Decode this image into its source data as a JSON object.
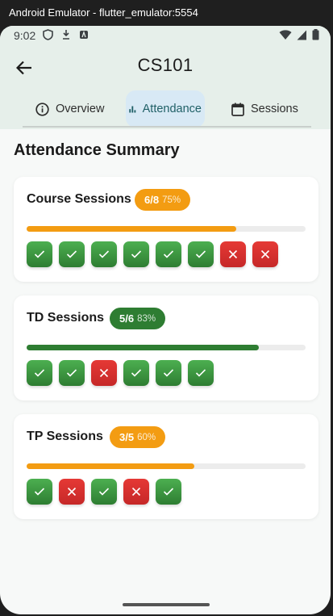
{
  "window": {
    "title": "Android Emulator - flutter_emulator:5554"
  },
  "status_bar": {
    "time": "9:02"
  },
  "app_bar": {
    "title": "CS101"
  },
  "tabs": [
    {
      "label": "Overview",
      "icon": "info-icon",
      "active": false
    },
    {
      "label": "Attendance",
      "icon": "bar-chart-icon",
      "active": true
    },
    {
      "label": "Sessions",
      "icon": "calendar-icon",
      "active": false
    }
  ],
  "section": {
    "title": "Attendance Summary"
  },
  "cards": [
    {
      "title": "Course Sessions",
      "count": "6/8",
      "percent": "75%",
      "progress": 0.75,
      "color": "#f39c12",
      "marks": [
        "present",
        "present",
        "present",
        "present",
        "present",
        "present",
        "absent",
        "absent"
      ]
    },
    {
      "title": "TD Sessions",
      "count": "5/6",
      "percent": "83%",
      "progress": 0.833,
      "color": "#2e7d32",
      "marks": [
        "present",
        "present",
        "absent",
        "present",
        "present",
        "present"
      ]
    },
    {
      "title": "TP Sessions",
      "count": "3/5",
      "percent": "60%",
      "progress": 0.6,
      "color": "#f39c12",
      "marks": [
        "present",
        "absent",
        "present",
        "absent",
        "present"
      ]
    }
  ]
}
